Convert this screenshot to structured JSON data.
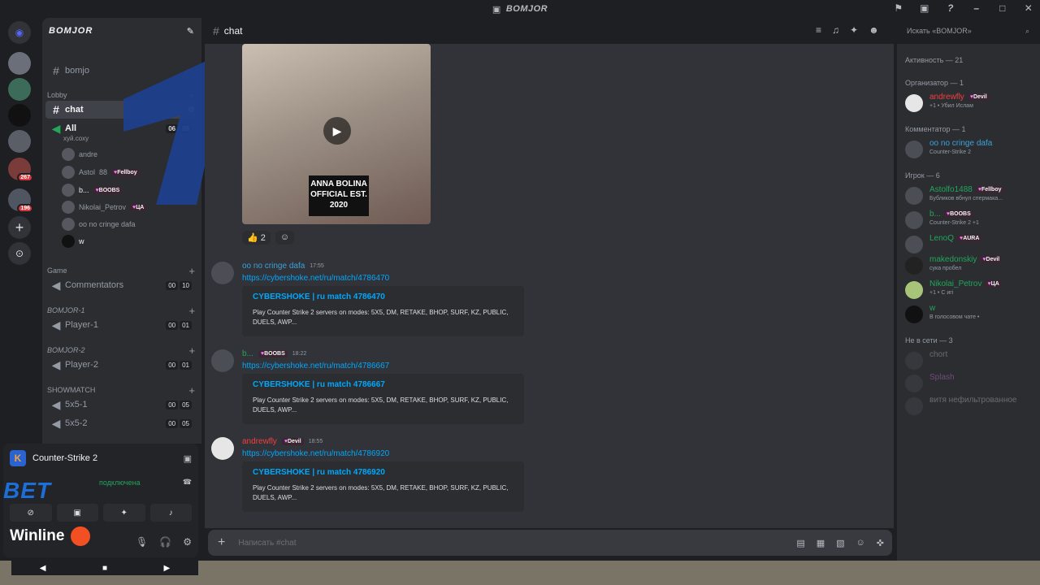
{
  "window": {
    "title": "BOMJOR"
  },
  "guild_rail": {
    "badges": [
      "267",
      "196"
    ]
  },
  "server": {
    "name": "BOMJOR"
  },
  "channels": {
    "top": "bomjo",
    "lobby_label": "Lobby",
    "chat": "chat",
    "all": "All",
    "all_sub": "хуй.соху",
    "all_counts": [
      "06",
      "99"
    ],
    "voice_users": [
      {
        "name": "andre",
        "tag": ""
      },
      {
        "name": "Astol",
        "extra": "88",
        "tag": "Fellboy"
      },
      {
        "name": "b...",
        "tag": "BOOBS"
      },
      {
        "name": "Nikolai_Petrov",
        "tag": "ЦА"
      },
      {
        "name": "oo no cringe dafa",
        "tag": ""
      },
      {
        "name": "w",
        "tag": ""
      }
    ],
    "categories": [
      {
        "label": "Game",
        "items": [
          {
            "name": "Commentators",
            "c": [
              "00",
              "10"
            ]
          }
        ]
      },
      {
        "label": "BOMJOR-1",
        "items": [
          {
            "name": "Player-1",
            "c": [
              "00",
              "01"
            ]
          }
        ]
      },
      {
        "label": "BOMJOR-2",
        "items": [
          {
            "name": "Player-2",
            "c": [
              "00",
              "01"
            ]
          }
        ]
      },
      {
        "label": "SHOWMATCH",
        "items": [
          {
            "name": "5x5-1",
            "c": [
              "00",
              "05"
            ]
          },
          {
            "name": "5x5-2",
            "c": [
              "00",
              "05"
            ]
          }
        ]
      }
    ]
  },
  "user_area": {
    "game": "Counter-Strike 2",
    "voice_status": "подключена",
    "bet": "BET",
    "winline": "Winline"
  },
  "chat": {
    "channel": "chat",
    "search_placeholder": "Искать «BOMJOR»",
    "video_brand": "ANNA BOLINA OFFICIAL EST. 2020",
    "reactions": [
      "👍 2",
      "☺"
    ],
    "messages": [
      {
        "name": "oo no cringe dafa",
        "tag": "",
        "time": "17:55",
        "link": "https://cybershoke.net/ru/match/4786470",
        "embed_title": "CYBERSHOKE | ru match 4786470",
        "embed_desc": "Play Counter Strike 2 servers on modes: 5X5, DM, RETAKE, BHOP, SURF, KZ, PUBLIC, DUELS, AWP..."
      },
      {
        "name": "b...",
        "tag": "BOOBS",
        "time": "18:22",
        "link": "https://cybershoke.net/ru/match/4786667",
        "embed_title": "CYBERSHOKE | ru match 4786667",
        "embed_desc": "Play Counter Strike 2 servers on modes: 5X5, DM, RETAKE, BHOP, SURF, KZ, PUBLIC, DUELS, AWP..."
      },
      {
        "name": "andrewfly",
        "tag": "Devil",
        "time": "18:55",
        "link": "https://cybershoke.net/ru/match/4786920",
        "embed_title": "CYBERSHOKE | ru match 4786920",
        "embed_desc": "Play Counter Strike 2 servers on modes: 5X5, DM, RETAKE, BHOP, SURF, KZ, PUBLIC, DUELS, AWP..."
      }
    ],
    "composer_placeholder": "Написать #chat"
  },
  "members": {
    "activity": "Активность — 21",
    "organizer": "Организатор — 1",
    "commentator": "Комментатор — 1",
    "players": "Игрок — 6",
    "offline": "Не в сети — 3",
    "list": [
      {
        "name": "andrewfly",
        "tag": "Devil",
        "status": "+1 • Убил Ислам",
        "color": "#f23f42"
      },
      {
        "name": "oo no cringe dafa",
        "tag": "",
        "status": "Counter-Strike 2",
        "color": "#3ba2d9"
      },
      {
        "name": "Astolfo1488",
        "tag": "Fellboy",
        "status": "Бубликов вбнул спермака...",
        "color": "#23a55a"
      },
      {
        "name": "b...",
        "tag": "BOOBS",
        "status": "Counter-Strike 2 +1",
        "color": "#23a55a"
      },
      {
        "name": "LenoQ",
        "tag": "AURA",
        "status": "",
        "color": "#23a55a"
      },
      {
        "name": "makedonskiy",
        "tag": "Devil",
        "status": "сука пробел",
        "color": "#23a55a"
      },
      {
        "name": "Nikolai_Petrov",
        "tag": "ЦА",
        "status": "+1 • С игі",
        "color": "#23a55a"
      },
      {
        "name": "w",
        "tag": "",
        "status": "В голосовом чате •",
        "color": "#23a55a"
      }
    ],
    "offline_list": [
      "chort",
      "Splash",
      "витя нефильтрованное"
    ]
  }
}
